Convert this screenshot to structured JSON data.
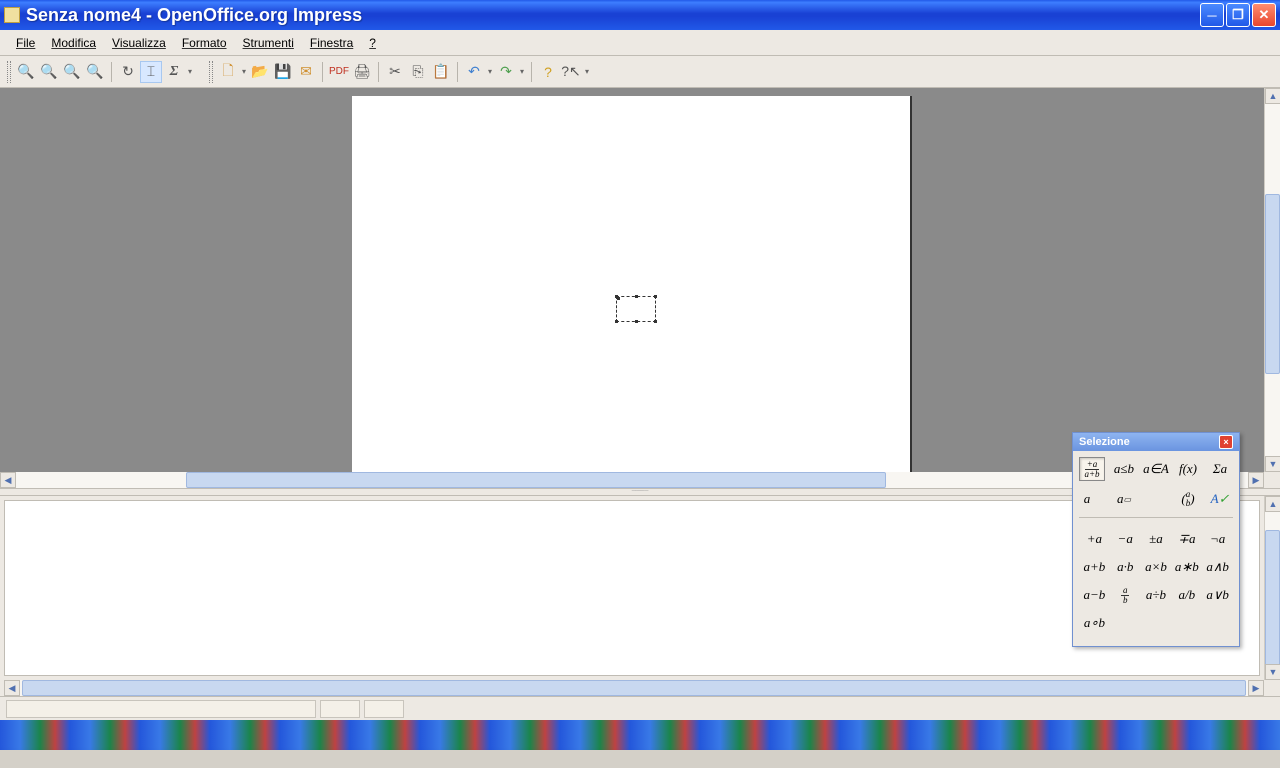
{
  "titlebar": {
    "title": "Senza nome4 - OpenOffice.org Impress"
  },
  "menubar": {
    "items": [
      "File",
      "Modifica",
      "Visualizza",
      "Formato",
      "Strumenti",
      "Finestra",
      "?"
    ]
  },
  "toolbar": {
    "group1": [
      "zoom-in",
      "zoom-out",
      "zoom-100",
      "zoom-page"
    ],
    "group2": [
      "refresh",
      "cursor",
      "sigma"
    ],
    "group3": [
      "new",
      "open",
      "save",
      "mail",
      "pdf",
      "print"
    ],
    "group4": [
      "cut",
      "copy",
      "paste"
    ],
    "group5": [
      "undo",
      "redo"
    ],
    "group6": [
      "help",
      "whatsthis"
    ]
  },
  "selezione": {
    "title": "Selezione",
    "categories_row1": [
      "+a/a+b",
      "a≤b",
      "a∈A",
      "f(x)",
      "Σa"
    ],
    "categories_row2": [
      "a⃗",
      "aꟿ",
      "",
      "(a/b)",
      "A✓"
    ],
    "operators": [
      [
        "+a",
        "−a",
        "±a",
        "∓a",
        "¬a"
      ],
      [
        "a+b",
        "a·b",
        "a×b",
        "a∗b",
        "a∧b"
      ],
      [
        "a−b",
        "a/b",
        "a÷b",
        "a/b",
        "a∨b"
      ],
      [
        "a∘b",
        "",
        "",
        "",
        ""
      ]
    ]
  }
}
